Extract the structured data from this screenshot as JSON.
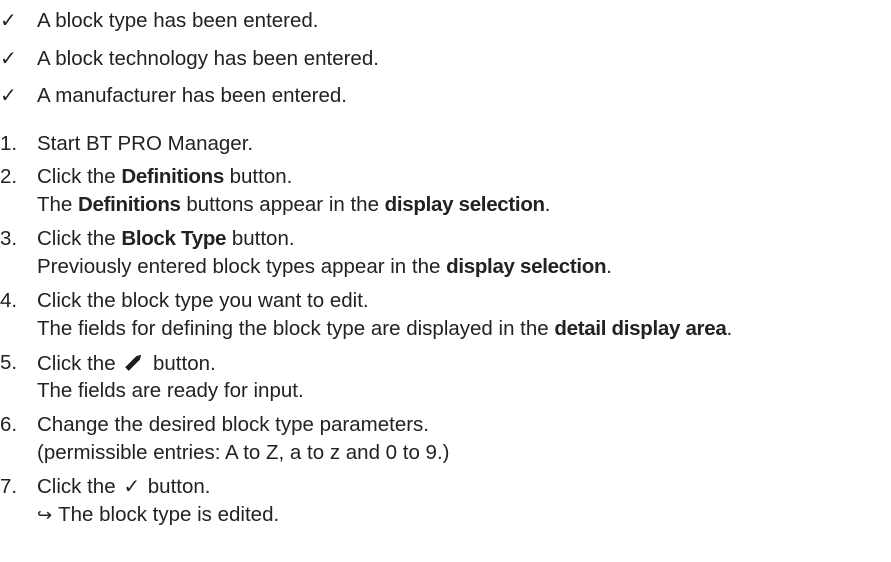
{
  "prerequisites": [
    "A block type has been entered.",
    "A block technology has been entered.",
    "A manufacturer has been entered."
  ],
  "check_symbol": "✓",
  "steps": [
    {
      "num": "1.",
      "line1": [
        "Start BT PRO Manager."
      ],
      "line2": null
    },
    {
      "num": "2.",
      "line1": [
        "Click the ",
        "Definitions",
        " button."
      ],
      "line2": [
        "The ",
        "Definitions",
        " buttons appear in the ",
        "display selection",
        "."
      ]
    },
    {
      "num": "3.",
      "line1": [
        "Click the ",
        "Block Type",
        " button."
      ],
      "line2": [
        "Previously entered block types appear in the ",
        "display selection",
        "."
      ]
    },
    {
      "num": "4.",
      "line1": [
        "Click the block type you want to edit."
      ],
      "line2": [
        "The fields for defining the block type are displayed in the ",
        "detail display area",
        "."
      ]
    },
    {
      "num": "5.",
      "line1_pre": "Click the ",
      "line1_post": " button.",
      "line2": [
        "The fields are ready for input."
      ]
    },
    {
      "num": "6.",
      "line1": [
        "Change the desired block type parameters."
      ],
      "line2": [
        "(permissible entries: A to Z, a to z and 0 to 9.)"
      ]
    },
    {
      "num": "7.",
      "line1_pre": "Click the ",
      "line1_post": " button.",
      "result_arrow": "↪",
      "result_text": "The block type is edited."
    }
  ],
  "icons": {
    "edit": "pencil-icon",
    "confirm": "checkmark-icon"
  }
}
